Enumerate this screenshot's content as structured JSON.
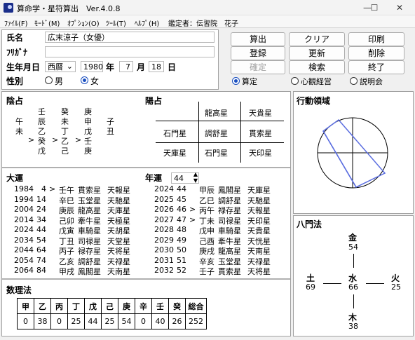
{
  "window": {
    "title": "算命学・星符算出",
    "version": "Ver.4.0.8",
    "min": "—",
    "max": "☐",
    "close": "✕"
  },
  "menu": [
    "ﾌｧｲﾙ(F)",
    "ﾓｰﾄﾞ(M)",
    "ｵﾌﾟｼｮﾝ(O)",
    "ﾂｰﾙ(T)",
    "ﾍﾙﾌﾟ(H)"
  ],
  "appraiser": "鑑定者：伝習院　花子",
  "form": {
    "name_label": "氏名",
    "name_value": "広末涼子（女優）",
    "kana_label": "ﾌﾘｶﾞﾅ",
    "kana_value": "",
    "birth_label": "生年月日",
    "era": "西暦",
    "year": "1980",
    "year_unit": "年",
    "month": "7",
    "month_unit": "月",
    "day": "18",
    "day_unit": "日",
    "sex_label": "性別",
    "male": "男",
    "female": "女"
  },
  "buttons": {
    "calc": "算出",
    "clear": "クリア",
    "print": "印刷",
    "register": "登録",
    "update": "更新",
    "delete": "削除",
    "confirm": "確定",
    "search": "検索",
    "exit": "終了"
  },
  "mode": {
    "calc": "算定",
    "kanshin": "心観経営",
    "seminar": "説明会"
  },
  "inyo": {
    "title": "陰占",
    "rows": [
      {
        "c1": "",
        "c2": "壬",
        "c3": "癸",
        "c4": "庚",
        "c5": ""
      },
      {
        "c1": "午",
        "c2": "辰",
        "c3": "未",
        "c4": "申",
        "c5": "子"
      },
      {
        "c1": "未",
        "c2": "乙",
        "c3": "丁",
        "c4": "戊",
        "c5": "丑"
      },
      {
        "c1": ">",
        "c2": "癸",
        "c3": ">",
        "c4": "乙",
        "c5": ">",
        "c6": "壬"
      },
      {
        "c2": "戊",
        "c3": "己",
        "c4": "庚"
      }
    ]
  },
  "yousen": {
    "title": "陽占",
    "cells": [
      "龍高星",
      "天貴星",
      "石門星",
      "調舒星",
      "貫索星",
      "天庫星",
      "石門星",
      "天印星"
    ]
  },
  "taiun": {
    "title": "大運",
    "rows": [
      {
        "year": "1984",
        "age": "4",
        "arrow": ">",
        "kanshi": "壬午",
        "star1": "貫索星",
        "star2": "天報星"
      },
      {
        "year": "1994",
        "age": "14",
        "arrow": "",
        "kanshi": "辛巳",
        "star1": "玉堂星",
        "star2": "天馳星"
      },
      {
        "year": "2004",
        "age": "24",
        "arrow": "",
        "kanshi": "庚辰",
        "star1": "龍高星",
        "star2": "天庫星"
      },
      {
        "year": "2014",
        "age": "34",
        "arrow": "",
        "kanshi": "己卯",
        "star1": "牽牛星",
        "star2": "天極星"
      },
      {
        "year": "2024",
        "age": "44",
        "arrow": "",
        "kanshi": "戊寅",
        "star1": "車騎星",
        "star2": "天胡星"
      },
      {
        "year": "2034",
        "age": "54",
        "arrow": "",
        "kanshi": "丁丑",
        "star1": "司禄星",
        "star2": "天堂星"
      },
      {
        "year": "2044",
        "age": "64",
        "arrow": "",
        "kanshi": "丙子",
        "star1": "禄存星",
        "star2": "天将星"
      },
      {
        "year": "2054",
        "age": "74",
        "arrow": "",
        "kanshi": "乙亥",
        "star1": "調舒星",
        "star2": "天禄星"
      },
      {
        "year": "2064",
        "age": "84",
        "arrow": "",
        "kanshi": "甲戌",
        "star1": "鳳閣星",
        "star2": "天南星"
      }
    ]
  },
  "nenun": {
    "title": "年運",
    "age": "44",
    "rows": [
      {
        "year": "2024",
        "age": "44",
        "arrow": "",
        "kanshi": "甲辰",
        "star1": "鳳閣星",
        "star2": "天庫星"
      },
      {
        "year": "2025",
        "age": "45",
        "arrow": "",
        "kanshi": "乙巳",
        "star1": "調舒星",
        "star2": "天馳星"
      },
      {
        "year": "2026",
        "age": "46",
        "arrow": ">",
        "kanshi": "丙午",
        "star1": "禄存星",
        "star2": "天報星"
      },
      {
        "year": "2027",
        "age": "47",
        "arrow": ">",
        "kanshi": "丁未",
        "star1": "司禄星",
        "star2": "天印星"
      },
      {
        "year": "2028",
        "age": "48",
        "arrow": "",
        "kanshi": "戊申",
        "star1": "車騎星",
        "star2": "天貴星"
      },
      {
        "year": "2029",
        "age": "49",
        "arrow": "",
        "kanshi": "己酉",
        "star1": "牽牛星",
        "star2": "天恍星"
      },
      {
        "year": "2030",
        "age": "50",
        "arrow": "",
        "kanshi": "庚戌",
        "star1": "龍高星",
        "star2": "天南星"
      },
      {
        "year": "2031",
        "age": "51",
        "arrow": "",
        "kanshi": "辛亥",
        "star1": "玉堂星",
        "star2": "天禄星"
      },
      {
        "year": "2032",
        "age": "52",
        "arrow": "",
        "kanshi": "壬子",
        "star1": "貫索星",
        "star2": "天将星"
      }
    ]
  },
  "suuri": {
    "title": "数理法",
    "headers": [
      "甲",
      "乙",
      "丙",
      "丁",
      "戊",
      "己",
      "庚",
      "辛",
      "壬",
      "癸",
      "総合"
    ],
    "values": [
      "0",
      "38",
      "0",
      "25",
      "44",
      "25",
      "54",
      "0",
      "40",
      "26",
      "252"
    ]
  },
  "koudou": {
    "title": "行動領域"
  },
  "hachimon": {
    "title": "八門法",
    "north": "金",
    "north_v": "54",
    "west": "土",
    "west_v": "69",
    "center": "水",
    "center_v": "66",
    "east": "火",
    "east_v": "25",
    "south": "木",
    "south_v": "38"
  }
}
